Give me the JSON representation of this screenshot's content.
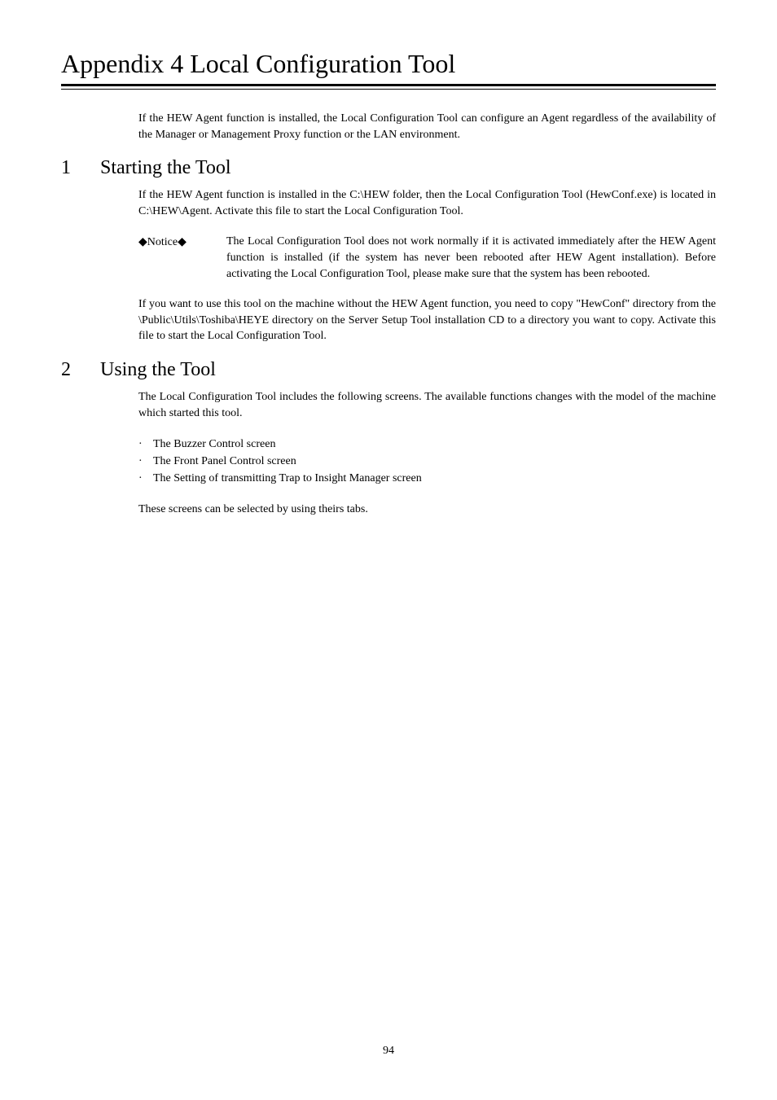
{
  "title": "Appendix 4     Local Configuration Tool",
  "intro": "If the HEW Agent function is installed, the Local Configuration Tool can configure an Agent regardless of the availability of the Manager or Management Proxy function or the LAN environment.",
  "sections": [
    {
      "num": "1",
      "title": "Starting the Tool",
      "paragraphs": [
        "If the HEW Agent function is installed in the C:\\HEW folder, then the Local Configuration Tool (HewConf.exe) is located in C:\\HEW\\Agent.    Activate this file to start the Local Configuration Tool."
      ],
      "notice": {
        "label_prefix": "◆",
        "label_text": "Notice",
        "label_suffix": "◆",
        "body": "The Local Configuration Tool does not work normally if it is activated immediately after the HEW Agent function is installed (if the system has never been rebooted after HEW Agent installation).   Before activating the Local Configuration Tool, please make sure that the system has been rebooted."
      },
      "paragraphs_after": [
        "If you want to use this tool on the machine without the HEW Agent function, you need to copy \"HewConf\" directory from the \\Public\\Utils\\Toshiba\\HEYE directory on the Server Setup Tool installation CD to a directory you want to copy. Activate this file to start the Local Configuration Tool."
      ]
    },
    {
      "num": "2",
      "title": "Using the Tool",
      "paragraphs": [
        "The Local Configuration Tool includes the following screens.    The available functions changes with the model of the machine which started this tool."
      ],
      "bullets": [
        "The Buzzer Control screen",
        "The Front Panel Control screen",
        "The Setting of transmitting Trap to Insight Manager screen"
      ],
      "paragraphs_after": [
        "These screens can be selected by using theirs tabs."
      ]
    }
  ],
  "page_number": "94"
}
